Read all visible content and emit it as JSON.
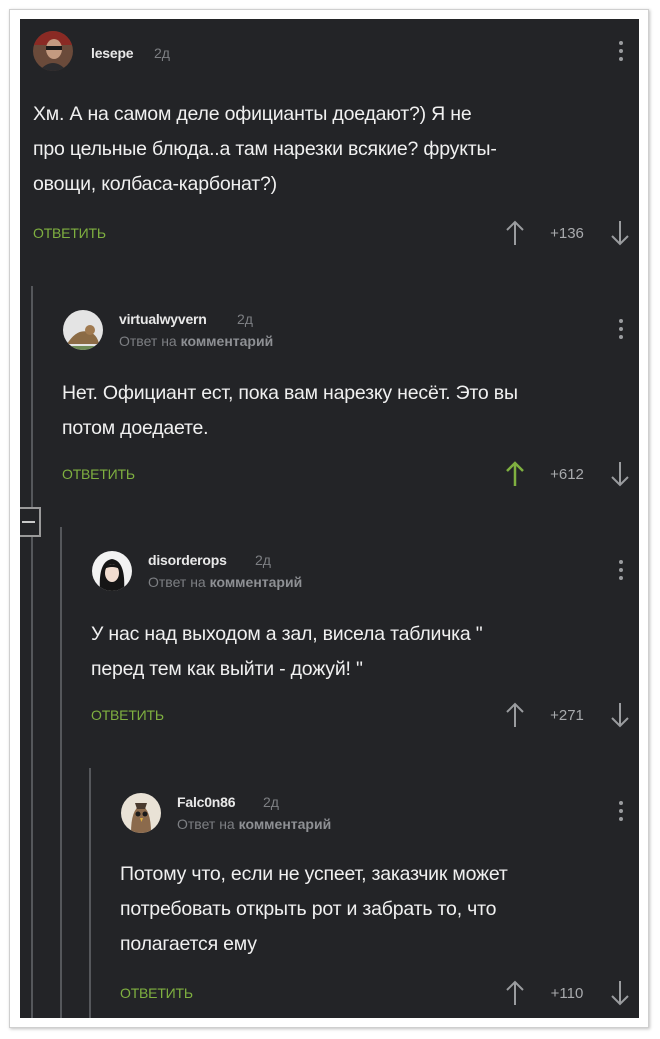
{
  "comments": [
    {
      "username": "lesepe",
      "time": "2д",
      "reply_to": null,
      "text": [
        "Хм. А на самом деле официанты доедают?) Я не",
        "про цельные блюда..а там нарезки всякие? фрукты-",
        "овощи, колбаса-карбонат?)"
      ],
      "reply_label": "ОТВЕТИТЬ",
      "score": "+136",
      "upvoted": false
    },
    {
      "username": "virtualwyvern",
      "time": "2д",
      "reply_to": {
        "prefix": "Ответ на",
        "target": "комментарий"
      },
      "text": [
        "Нет. Официант ест, пока вам нарезку несёт. Это вы",
        "потом доедаете."
      ],
      "reply_label": "ОТВЕТИТЬ",
      "score": "+612",
      "upvoted": true
    },
    {
      "username": "disorderops",
      "time": "2д",
      "reply_to": {
        "prefix": "Ответ на",
        "target": "комментарий"
      },
      "text": [
        "У нас над выходом а зал, висела табличка \"",
        "перед тем как выйти - дожуй! \""
      ],
      "reply_label": "ОТВЕТИТЬ",
      "score": "+271",
      "upvoted": false
    },
    {
      "username": "Falc0n86",
      "time": "2д",
      "reply_to": {
        "prefix": "Ответ на",
        "target": "комментарий"
      },
      "text": [
        "Потому что, если не успеет, заказчик может",
        "потребовать открыть рот и забрать то, что",
        "полагается ему"
      ],
      "reply_label": "ОТВЕТИТЬ",
      "score": "+110",
      "upvoted": false
    }
  ],
  "colors": {
    "background": "#232427",
    "accent_green": "#7fb040",
    "text": "#f0f0f0",
    "muted": "#7d7f83"
  },
  "icons": [
    "kebab-menu-icon",
    "arrow-up-icon",
    "arrow-down-icon",
    "collapse-thread-icon"
  ]
}
